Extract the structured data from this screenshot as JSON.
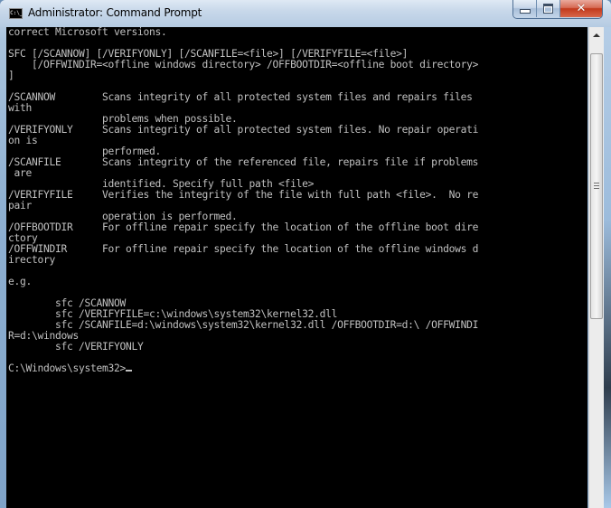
{
  "window": {
    "title": "Administrator: Command Prompt",
    "icon": "cmd-icon",
    "icon_label": "C:\\_",
    "buttons": {
      "minimize": "minimize",
      "maximize": "maximize",
      "close": "✕"
    }
  },
  "console": {
    "lines": [
      "correct Microsoft versions.",
      "",
      "SFC [/SCANNOW] [/VERIFYONLY] [/SCANFILE=<file>] [/VERIFYFILE=<file>]",
      "    [/OFFWINDIR=<offline windows directory> /OFFBOOTDIR=<offline boot directory>",
      "]",
      "",
      "/SCANNOW        Scans integrity of all protected system files and repairs files",
      "with",
      "                problems when possible.",
      "/VERIFYONLY     Scans integrity of all protected system files. No repair operati",
      "on is",
      "                performed.",
      "/SCANFILE       Scans integrity of the referenced file, repairs file if problems",
      " are",
      "                identified. Specify full path <file>",
      "/VERIFYFILE     Verifies the integrity of the file with full path <file>.  No re",
      "pair",
      "                operation is performed.",
      "/OFFBOOTDIR     For offline repair specify the location of the offline boot dire",
      "ctory",
      "/OFFWINDIR      For offline repair specify the location of the offline windows d",
      "irectory",
      "",
      "e.g.",
      "",
      "        sfc /SCANNOW",
      "        sfc /VERIFYFILE=c:\\windows\\system32\\kernel32.dll",
      "        sfc /SCANFILE=d:\\windows\\system32\\kernel32.dll /OFFBOOTDIR=d:\\ /OFFWINDI",
      "R=d:\\windows",
      "        sfc /VERIFYONLY",
      ""
    ],
    "prompt": "C:\\Windows\\system32>",
    "colors": {
      "background": "#000000",
      "text": "#c0c0c0"
    }
  },
  "scrollbar": {
    "orientation": "vertical",
    "position_fraction": 0.05,
    "visible_fraction": 0.55
  }
}
